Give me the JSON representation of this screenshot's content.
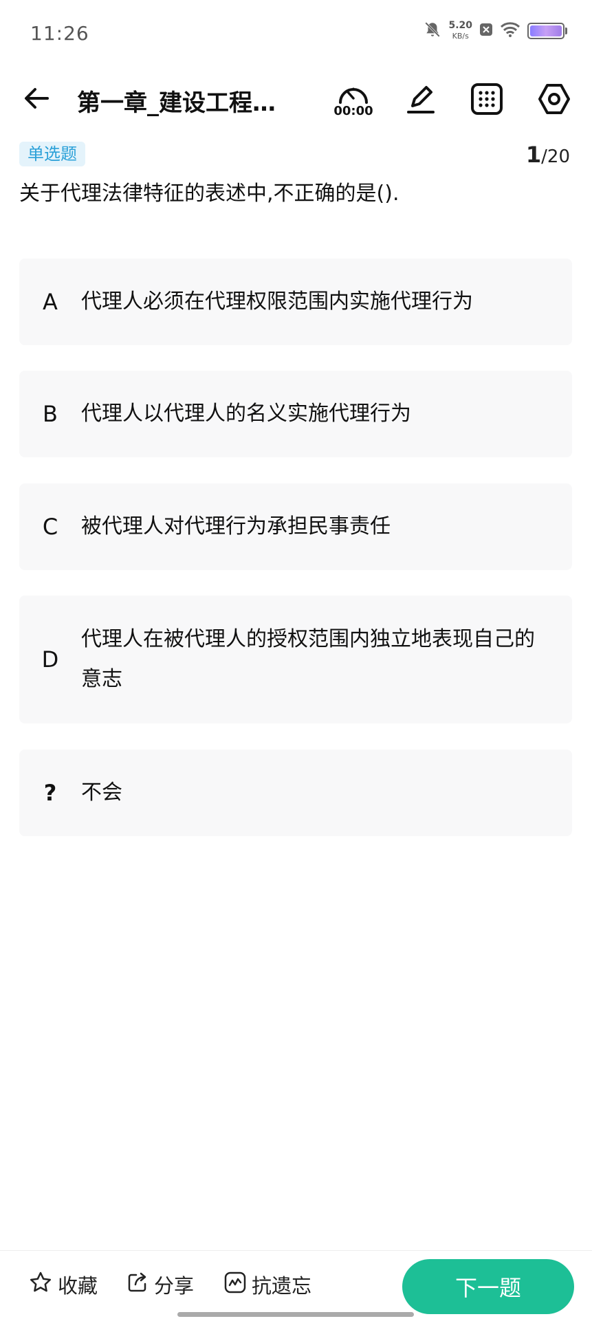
{
  "status": {
    "time": "11:26",
    "net_speed": "5.20",
    "net_unit": "KB/s"
  },
  "header": {
    "title": "第一章_建设工程…",
    "timer": "00:00"
  },
  "question": {
    "type_badge": "单选题",
    "current": "1",
    "total": "/20",
    "text": "关于代理法律特征的表述中,不正确的是()."
  },
  "options": [
    {
      "letter": "A",
      "text": "代理人必须在代理权限范围内实施代理行为"
    },
    {
      "letter": "B",
      "text": "代理人以代理人的名义实施代理行为"
    },
    {
      "letter": "C",
      "text": "被代理人对代理行为承担民事责任"
    },
    {
      "letter": "D",
      "text": "代理人在被代理人的授权范围内独立地表现自己的意志"
    },
    {
      "letter": "?",
      "text": "不会"
    }
  ],
  "bottom": {
    "favorite": "收藏",
    "share": "分享",
    "anti_forget": "抗遗忘",
    "next": "下一题"
  },
  "colors": {
    "accent": "#1dbf96",
    "badge_text": "#2aa0d8",
    "badge_bg": "#e4f3fb",
    "option_bg": "#f8f8f9"
  },
  "icons": [
    "back-arrow-icon",
    "timer-icon",
    "edit-pen-icon",
    "grid-icon",
    "settings-hexagon-icon",
    "star-icon",
    "share-icon",
    "chart-line-icon",
    "mute-bell-icon",
    "wifi-icon",
    "battery-icon"
  ]
}
